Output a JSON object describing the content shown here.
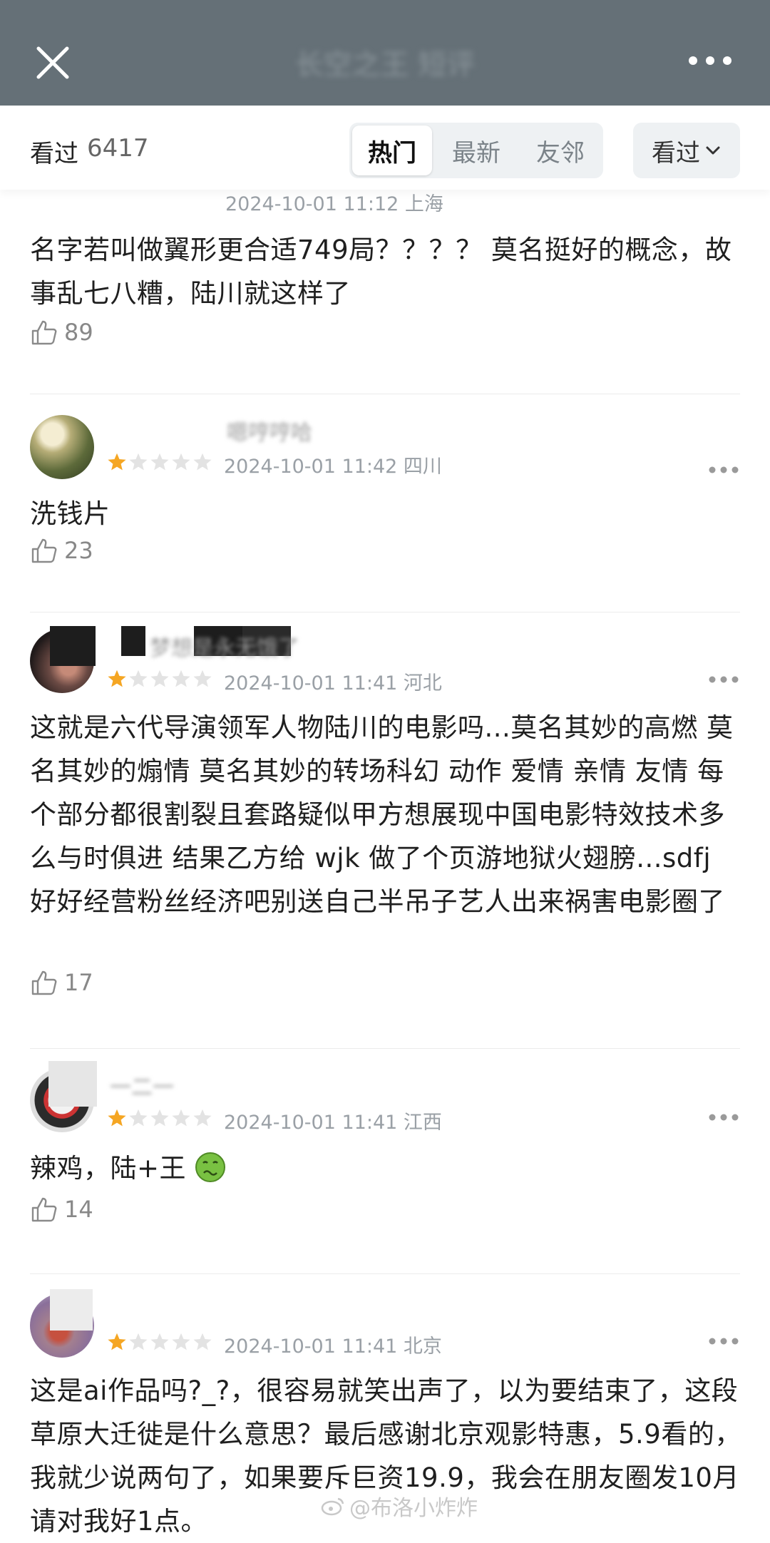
{
  "topbar": {
    "title": "长空之王 短评"
  },
  "filter": {
    "seen_label": "看过",
    "seen_count": "6417",
    "tabs": [
      "热门",
      "最新",
      "友邻"
    ],
    "active_tab": "热门",
    "sort_label": "看过"
  },
  "reviews": [
    {
      "meta": "2024-10-01 11:12 上海",
      "content": "名字若叫做翼形更合适749局？？？？ 莫名挺好的概念，故事乱七八糟，陆川就这样了",
      "likes": "89"
    },
    {
      "username": "嗯哼哼哈",
      "rating": 1,
      "meta": "2024-10-01 11:42 四川",
      "content": "洗钱片",
      "likes": "23"
    },
    {
      "username": "梦想是永无饿了",
      "rating": 1,
      "meta": "2024-10-01 11:41 河北",
      "content": "这就是六代导演领军人物陆川的电影吗...莫名其妙的高燃 莫名其妙的煽情 莫名其妙的转场科幻 动作 爱情 亲情 友情 每个部分都很割裂且套路疑似甲方想展现中国电影特效技术多么与时俱进 结果乙方给 wjk 做了个页游地狱火翅膀...sdfj 好好经营粉丝经济吧别送自己半吊子艺人出来祸害电影圈了",
      "likes": "17"
    },
    {
      "username": "一二一",
      "rating": 1,
      "meta": "2024-10-01 11:41 江西",
      "content": "辣鸡，陆+王",
      "likes": "14"
    },
    {
      "username": "",
      "rating": 1,
      "meta": "2024-10-01 11:41 北京",
      "content": "这是ai作品吗?_?，很容易就笑出声了，以为要结束了，这段草原大迁徙是什么意思？最后感谢北京观影特惠，5.9看的，我就少说两句了，如果要斥巨资19.9，我会在朋友圈发10月请对我好1点。",
      "likes": ""
    }
  ],
  "watermark": "@布洛小炸炸",
  "colors": {
    "topbar": "#657077",
    "star_on": "#f5a623",
    "star_off": "#e3e3e3",
    "emoji": "#79c142"
  }
}
